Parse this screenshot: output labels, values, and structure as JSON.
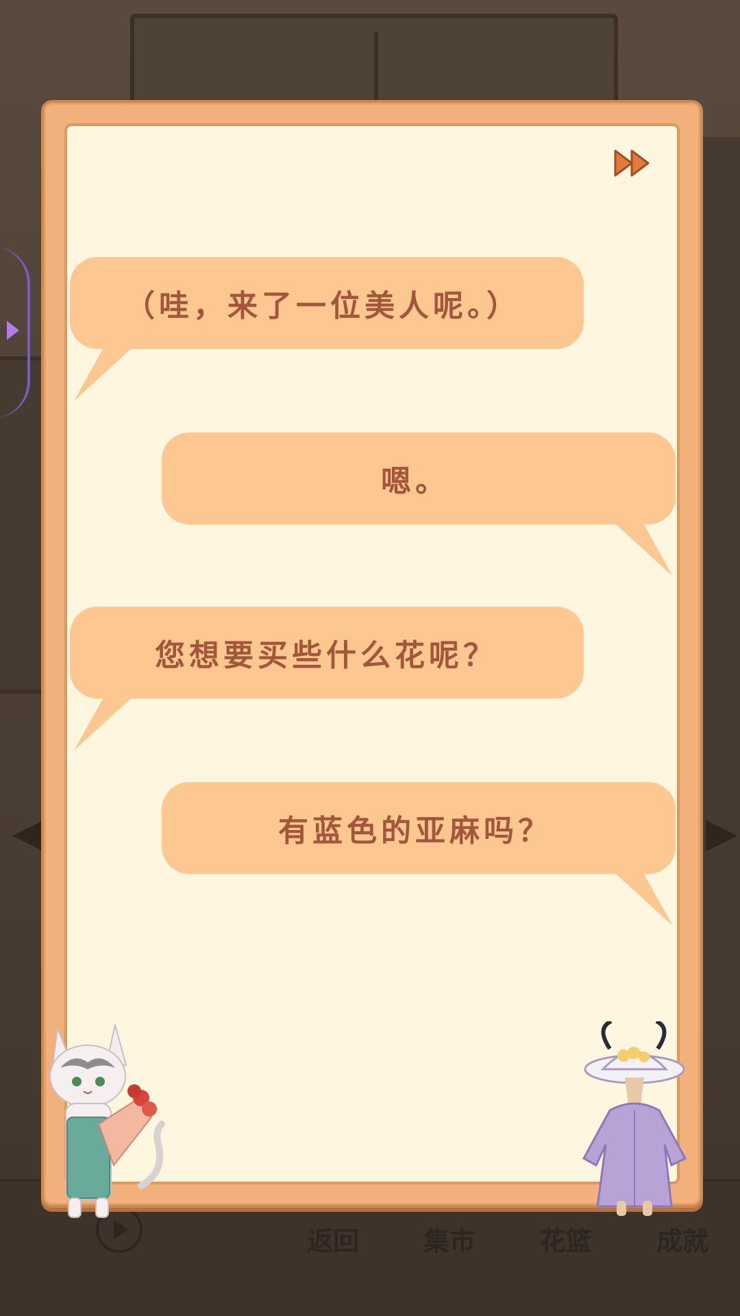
{
  "background_nav": {
    "items": [
      "返回",
      "集市",
      "花篮",
      "成就"
    ]
  },
  "dialog": {
    "skip_icon": "fast-forward-icon",
    "lines": [
      {
        "speaker": "cat-shopkeeper",
        "side": "left",
        "text": "（哇，来了一位美人呢。）"
      },
      {
        "speaker": "customer",
        "side": "right",
        "text": "嗯。"
      },
      {
        "speaker": "cat-shopkeeper",
        "side": "left",
        "text": "您想要买些什么花呢？"
      },
      {
        "speaker": "customer",
        "side": "right",
        "text": "有蓝色的亚麻吗？"
      }
    ]
  },
  "colors": {
    "frame": "#f2b17c",
    "paper": "#fff6df",
    "bubble": "#fdc791",
    "bubble_text": "#a2573b",
    "skip_icon": "#e27a3e"
  }
}
